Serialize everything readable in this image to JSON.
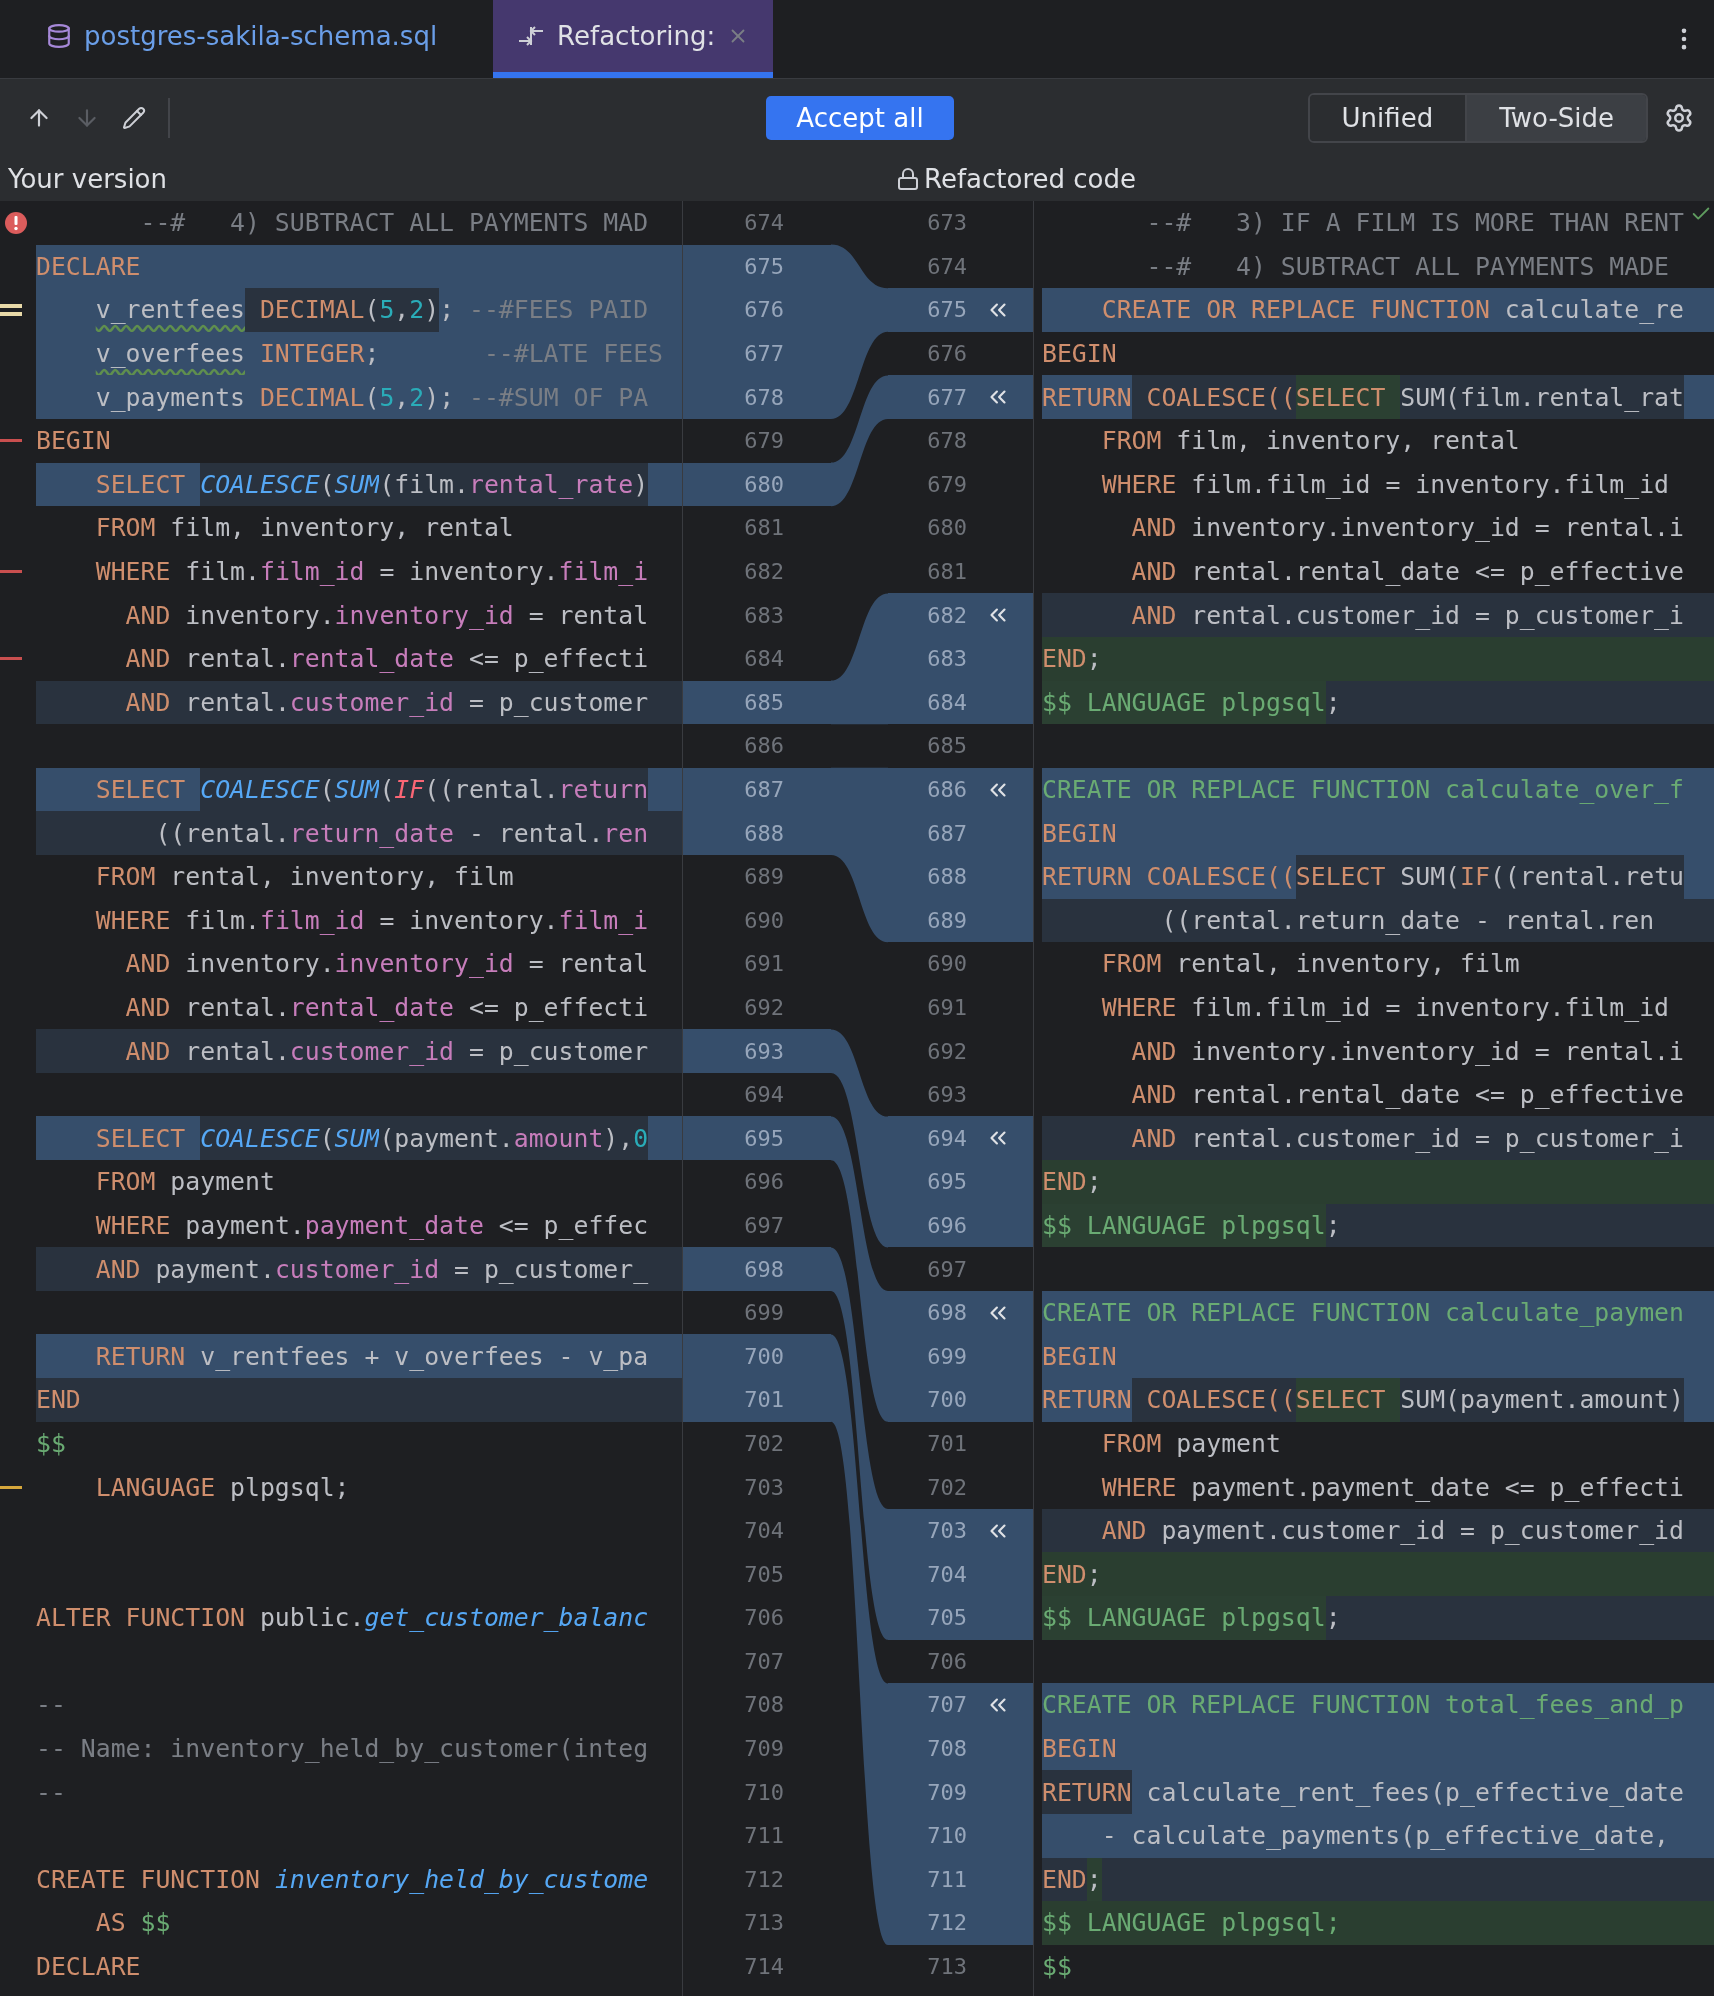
{
  "tabs": [
    {
      "label": "postgres-sakila-schema.sql",
      "kind": "file",
      "selected": false,
      "closable": false
    },
    {
      "label": "Refactoring:",
      "kind": "diff",
      "selected": true,
      "closable": true
    }
  ],
  "toolbar": {
    "nav": [
      {
        "kind": "up",
        "disabled": false
      },
      {
        "kind": "down",
        "disabled": true
      },
      {
        "kind": "edit",
        "disabled": false
      }
    ],
    "accept_button": "Accept all",
    "view_modes": [
      {
        "label": "Unified",
        "selected": false
      },
      {
        "label": "Two-Side",
        "selected": true
      }
    ]
  },
  "panes": {
    "left_title": "Your version",
    "right_title": "Refactored code",
    "right_locked": true
  },
  "rows": [
    {
      "left": {
        "num": "674",
        "kind": "context",
        "marker": {
          "kind": "error"
        },
        "code": [
          {
            "kind": "com",
            "text": "       --#   4) SUBTRACT ALL PAYMENTS MAD"
          }
        ]
      },
      "right": {
        "num": "673",
        "kind": "context",
        "code": [
          {
            "kind": "com",
            "text": "       --#   3) IF A FILM IS MORE THAN RENT"
          }
        ]
      }
    },
    {
      "left": {
        "num": "675",
        "kind": "changed",
        "code": [
          {
            "kind": "kw",
            "text": "DECLARE"
          }
        ]
      },
      "right": {
        "num": "674",
        "kind": "context",
        "code": [
          {
            "kind": "com",
            "text": "       --#   4) SUBTRACT ALL PAYMENTS MADE"
          }
        ]
      }
    },
    {
      "left": {
        "num": "676",
        "kind": "changed",
        "marker": {
          "kind": "warning"
        },
        "code": [
          {
            "kind": "pw",
            "text": "    v_rentfees"
          },
          {
            "kind": "kw",
            "text": " DECIMAL",
            "highlighted": true
          },
          {
            "kind": "p",
            "text": "(",
            "highlighted": true
          },
          {
            "kind": "num",
            "text": "5",
            "highlighted": true
          },
          {
            "kind": "p",
            "text": ",",
            "highlighted": true
          },
          {
            "kind": "num",
            "text": "2",
            "highlighted": true
          },
          {
            "kind": "p",
            "text": ")",
            "highlighted": true
          },
          {
            "kind": "p",
            "text": ";"
          },
          {
            "kind": "com",
            "text": " --#FEES PAID"
          }
        ]
      },
      "right": {
        "num": "675",
        "kind": "changed",
        "code": [
          {
            "kind": "kw",
            "text": "    CREATE OR REPLACE FUNCTION"
          },
          {
            "kind": "p",
            "text": " calculate_re"
          }
        ]
      }
    },
    {
      "left": {
        "num": "677",
        "kind": "changed",
        "code": [
          {
            "kind": "pw",
            "text": "    v_overfees"
          },
          {
            "kind": "kw",
            "text": " INTEGER"
          },
          {
            "kind": "p",
            "text": ";"
          },
          {
            "kind": "com",
            "text": "       --#LATE FEES"
          }
        ]
      },
      "right": {
        "num": "676",
        "kind": "context",
        "code": [
          {
            "kind": "kw",
            "text": "BEGIN"
          }
        ]
      }
    },
    {
      "left": {
        "num": "678",
        "kind": "changed",
        "code": [
          {
            "kind": "p",
            "text": "    v_payments"
          },
          {
            "kind": "kw",
            "text": " DECIMAL"
          },
          {
            "kind": "p",
            "text": "("
          },
          {
            "kind": "num",
            "text": "5"
          },
          {
            "kind": "p",
            "text": ","
          },
          {
            "kind": "num",
            "text": "2"
          },
          {
            "kind": "p",
            "text": ");"
          },
          {
            "kind": "com",
            "text": " --#SUM OF PA"
          }
        ]
      },
      "right": {
        "num": "677",
        "kind": "changed",
        "code": [
          {
            "kind": "kw",
            "text": "RETURN"
          },
          {
            "kind": "kw",
            "text": " COALESCE((",
            "highlighted": true
          },
          {
            "kind": "kw",
            "text": "SELECT ",
            "inserted": true
          },
          {
            "kind": "p",
            "text": "SUM(film.rental_rat",
            "highlighted": true
          }
        ]
      }
    },
    {
      "left": {
        "num": "679",
        "kind": "context",
        "marker": {
          "kind": "error-line"
        },
        "code": [
          {
            "kind": "kw",
            "text": "BEGIN"
          }
        ]
      },
      "right": {
        "num": "678",
        "kind": "context",
        "code": [
          {
            "kind": "kw",
            "text": "    FROM"
          },
          {
            "kind": "p",
            "text": " film, inventory, rental"
          }
        ]
      }
    },
    {
      "left": {
        "num": "680",
        "kind": "changed",
        "code": [
          {
            "kind": "kw",
            "text": "    SELECT "
          },
          {
            "kind": "fn",
            "text": "COALESCE",
            "highlighted": true
          },
          {
            "kind": "p",
            "text": "(",
            "highlighted": true
          },
          {
            "kind": "fn",
            "text": "SUM",
            "highlighted": true
          },
          {
            "kind": "p",
            "text": "(film.",
            "highlighted": true
          },
          {
            "kind": "field",
            "text": "rental_rate",
            "highlighted": true
          },
          {
            "kind": "p",
            "text": ")",
            "highlighted": true
          }
        ]
      },
      "right": {
        "num": "679",
        "kind": "context",
        "code": [
          {
            "kind": "kw",
            "text": "    WHERE"
          },
          {
            "kind": "p",
            "text": " film.film_id = inventory.film_id"
          }
        ]
      }
    },
    {
      "left": {
        "num": "681",
        "kind": "context",
        "code": [
          {
            "kind": "kw",
            "text": "    FROM"
          },
          {
            "kind": "p",
            "text": " film, inventory, rental"
          }
        ]
      },
      "right": {
        "num": "680",
        "kind": "context",
        "code": [
          {
            "kind": "kw",
            "text": "      AND"
          },
          {
            "kind": "p",
            "text": " inventory.inventory_id = rental.i"
          }
        ]
      }
    },
    {
      "left": {
        "num": "682",
        "kind": "context",
        "marker": {
          "kind": "error-line"
        },
        "code": [
          {
            "kind": "kw",
            "text": "    WHERE"
          },
          {
            "kind": "p",
            "text": " film."
          },
          {
            "kind": "field",
            "text": "film_id"
          },
          {
            "kind": "p",
            "text": " = inventory."
          },
          {
            "kind": "field",
            "text": "film_i"
          }
        ]
      },
      "right": {
        "num": "681",
        "kind": "context",
        "code": [
          {
            "kind": "kw",
            "text": "      AND"
          },
          {
            "kind": "p",
            "text": " rental.rental_date <= p_effective"
          }
        ]
      }
    },
    {
      "left": {
        "num": "683",
        "kind": "context",
        "code": [
          {
            "kind": "kw",
            "text": "      AND"
          },
          {
            "kind": "p",
            "text": " inventory."
          },
          {
            "kind": "field",
            "text": "inventory_id"
          },
          {
            "kind": "p",
            "text": " = rental"
          }
        ]
      },
      "right": {
        "num": "682",
        "kind": "modified",
        "code": [
          {
            "kind": "kw",
            "text": "      AND"
          },
          {
            "kind": "p",
            "text": " rental.customer_id = p_customer_i"
          }
        ]
      }
    },
    {
      "left": {
        "num": "684",
        "kind": "context",
        "marker": {
          "kind": "error-line"
        },
        "code": [
          {
            "kind": "kw",
            "text": "      AND"
          },
          {
            "kind": "p",
            "text": " rental."
          },
          {
            "kind": "field",
            "text": "rental_date"
          },
          {
            "kind": "p",
            "text": " <= p_effecti"
          }
        ]
      },
      "right": {
        "num": "683",
        "kind": "inserted",
        "code": [
          {
            "kind": "kw",
            "text": "END"
          },
          {
            "kind": "p",
            "text": ";"
          }
        ]
      }
    },
    {
      "left": {
        "num": "685",
        "kind": "modified",
        "code": [
          {
            "kind": "kw",
            "text": "      AND"
          },
          {
            "kind": "p",
            "text": " rental."
          },
          {
            "kind": "field",
            "text": "customer_id"
          },
          {
            "kind": "p",
            "text": " = p_customer"
          }
        ]
      },
      "right": {
        "num": "684",
        "kind": "modified",
        "code": [
          {
            "kind": "str",
            "text": "$$ LANGUAGE plpgsql",
            "inserted": true
          },
          {
            "kind": "p",
            "text": ";"
          }
        ]
      }
    },
    {
      "left": {
        "num": "686",
        "kind": "context"
      },
      "right": {
        "num": "685",
        "kind": "context"
      }
    },
    {
      "left": {
        "num": "687",
        "kind": "changed",
        "code": [
          {
            "kind": "kw",
            "text": "    SELECT "
          },
          {
            "kind": "fn",
            "text": "COALESCE",
            "highlighted": true
          },
          {
            "kind": "p",
            "text": "(",
            "highlighted": true
          },
          {
            "kind": "fn",
            "text": "SUM",
            "highlighted": true
          },
          {
            "kind": "p",
            "text": "(",
            "highlighted": true
          },
          {
            "kind": "fnred",
            "text": "IF",
            "highlighted": true
          },
          {
            "kind": "p",
            "text": "((rental.",
            "highlighted": true
          },
          {
            "kind": "field",
            "text": "return",
            "highlighted": true
          }
        ]
      },
      "right": {
        "num": "686",
        "kind": "changed",
        "code": [
          {
            "kind": "str",
            "text": "CREATE OR REPLACE FUNCTION calculate_over_f"
          }
        ]
      }
    },
    {
      "left": {
        "num": "688",
        "kind": "modified",
        "code": [
          {
            "kind": "p",
            "text": "        ((rental."
          },
          {
            "kind": "field",
            "text": "return_date"
          },
          {
            "kind": "p",
            "text": " - rental."
          },
          {
            "kind": "field",
            "text": "ren"
          }
        ]
      },
      "right": {
        "num": "687",
        "kind": "changed",
        "code": [
          {
            "kind": "kw",
            "text": "BEGIN"
          }
        ]
      }
    },
    {
      "left": {
        "num": "689",
        "kind": "context",
        "code": [
          {
            "kind": "kw",
            "text": "    FROM"
          },
          {
            "kind": "p",
            "text": " rental, inventory, film"
          }
        ]
      },
      "right": {
        "num": "688",
        "kind": "changed",
        "code": [
          {
            "kind": "kw",
            "text": "RETURN"
          },
          {
            "kind": "kw",
            "text": " COALESCE(("
          },
          {
            "kind": "kw",
            "text": "SELECT",
            "highlighted": true
          },
          {
            "kind": "p",
            "text": " SUM(",
            "highlighted": true
          },
          {
            "kind": "kw",
            "text": "IF",
            "highlighted": true
          },
          {
            "kind": "p",
            "text": "((rental.retu",
            "highlighted": true
          }
        ]
      }
    },
    {
      "left": {
        "num": "690",
        "kind": "context",
        "code": [
          {
            "kind": "kw",
            "text": "    WHERE"
          },
          {
            "kind": "p",
            "text": " film."
          },
          {
            "kind": "field",
            "text": "film_id"
          },
          {
            "kind": "p",
            "text": " = inventory."
          },
          {
            "kind": "field",
            "text": "film_i"
          }
        ]
      },
      "right": {
        "num": "689",
        "kind": "modified",
        "code": [
          {
            "kind": "p",
            "text": "        ((rental.return_date - rental.ren"
          }
        ]
      }
    },
    {
      "left": {
        "num": "691",
        "kind": "context",
        "code": [
          {
            "kind": "kw",
            "text": "      AND"
          },
          {
            "kind": "p",
            "text": " inventory."
          },
          {
            "kind": "field",
            "text": "inventory_id"
          },
          {
            "kind": "p",
            "text": " = rental"
          }
        ]
      },
      "right": {
        "num": "690",
        "kind": "context",
        "code": [
          {
            "kind": "kw",
            "text": "    FROM"
          },
          {
            "kind": "p",
            "text": " rental, inventory, film"
          }
        ]
      }
    },
    {
      "left": {
        "num": "692",
        "kind": "context",
        "code": [
          {
            "kind": "kw",
            "text": "      AND"
          },
          {
            "kind": "p",
            "text": " rental."
          },
          {
            "kind": "field",
            "text": "rental_date"
          },
          {
            "kind": "p",
            "text": " <= p_effecti"
          }
        ]
      },
      "right": {
        "num": "691",
        "kind": "context",
        "code": [
          {
            "kind": "kw",
            "text": "    WHERE"
          },
          {
            "kind": "p",
            "text": " film.film_id = inventory.film_id"
          }
        ]
      }
    },
    {
      "left": {
        "num": "693",
        "kind": "modified",
        "code": [
          {
            "kind": "kw",
            "text": "      AND"
          },
          {
            "kind": "p",
            "text": " rental."
          },
          {
            "kind": "field",
            "text": "customer_id"
          },
          {
            "kind": "p",
            "text": " = p_customer"
          }
        ]
      },
      "right": {
        "num": "692",
        "kind": "context",
        "code": [
          {
            "kind": "kw",
            "text": "      AND"
          },
          {
            "kind": "p",
            "text": " inventory.inventory_id = rental.i"
          }
        ]
      }
    },
    {
      "left": {
        "num": "694",
        "kind": "context"
      },
      "right": {
        "num": "693",
        "kind": "context",
        "code": [
          {
            "kind": "kw",
            "text": "      AND"
          },
          {
            "kind": "p",
            "text": " rental.rental_date <= p_effective"
          }
        ]
      }
    },
    {
      "left": {
        "num": "695",
        "kind": "changed",
        "code": [
          {
            "kind": "kw",
            "text": "    SELECT "
          },
          {
            "kind": "fn",
            "text": "COALESCE",
            "highlighted": true
          },
          {
            "kind": "p",
            "text": "(",
            "highlighted": true
          },
          {
            "kind": "fn",
            "text": "SUM",
            "highlighted": true
          },
          {
            "kind": "p",
            "text": "(payment.",
            "highlighted": true
          },
          {
            "kind": "field",
            "text": "amount",
            "highlighted": true
          },
          {
            "kind": "p",
            "text": ")",
            "highlighted": true
          },
          {
            "kind": "p",
            "text": ",",
            "highlighted": true
          },
          {
            "kind": "num",
            "text": "0",
            "highlighted": true
          }
        ]
      },
      "right": {
        "num": "694",
        "kind": "modified",
        "code": [
          {
            "kind": "kw",
            "text": "      AND"
          },
          {
            "kind": "p",
            "text": " rental.customer_id = p_customer_i"
          }
        ]
      }
    },
    {
      "left": {
        "num": "696",
        "kind": "context",
        "code": [
          {
            "kind": "kw",
            "text": "    FROM"
          },
          {
            "kind": "p",
            "text": " payment"
          }
        ]
      },
      "right": {
        "num": "695",
        "kind": "inserted",
        "code": [
          {
            "kind": "kw",
            "text": "END"
          },
          {
            "kind": "p",
            "text": ";"
          }
        ]
      }
    },
    {
      "left": {
        "num": "697",
        "kind": "context",
        "code": [
          {
            "kind": "kw",
            "text": "    WHERE"
          },
          {
            "kind": "p",
            "text": " payment."
          },
          {
            "kind": "field",
            "text": "payment_date"
          },
          {
            "kind": "p",
            "text": " <= p_effec"
          }
        ]
      },
      "right": {
        "num": "696",
        "kind": "modified",
        "code": [
          {
            "kind": "str",
            "text": "$$ LANGUAGE plpgsql",
            "inserted": true
          },
          {
            "kind": "p",
            "text": ";"
          }
        ]
      }
    },
    {
      "left": {
        "num": "698",
        "kind": "modified",
        "code": [
          {
            "kind": "kw",
            "text": "    AND"
          },
          {
            "kind": "p",
            "text": " payment."
          },
          {
            "kind": "field",
            "text": "customer_id"
          },
          {
            "kind": "p",
            "text": " = p_customer_"
          }
        ]
      },
      "right": {
        "num": "697",
        "kind": "context"
      }
    },
    {
      "left": {
        "num": "699",
        "kind": "context"
      },
      "right": {
        "num": "698",
        "kind": "changed",
        "code": [
          {
            "kind": "str",
            "text": "CREATE OR REPLACE FUNCTION calculate_paymen"
          }
        ]
      }
    },
    {
      "left": {
        "num": "700",
        "kind": "changed",
        "code": [
          {
            "kind": "kw",
            "text": "    RETURN "
          },
          {
            "kind": "p",
            "text": "v_rentfees + v_overfees - v_pa"
          }
        ]
      },
      "right": {
        "num": "699",
        "kind": "changed",
        "code": [
          {
            "kind": "kw",
            "text": "BEGIN"
          }
        ]
      }
    },
    {
      "left": {
        "num": "701",
        "kind": "modified",
        "code": [
          {
            "kind": "kw",
            "text": "END"
          }
        ]
      },
      "right": {
        "num": "700",
        "kind": "changed",
        "code": [
          {
            "kind": "kw",
            "text": "RETURN"
          },
          {
            "kind": "kw",
            "text": " COALESCE((",
            "highlighted": true
          },
          {
            "kind": "kw",
            "text": "SELECT ",
            "inserted": true
          },
          {
            "kind": "p",
            "text": "SUM(payment.amount)",
            "highlighted": true
          }
        ]
      }
    },
    {
      "left": {
        "num": "702",
        "kind": "context",
        "code": [
          {
            "kind": "str",
            "text": "$$"
          }
        ]
      },
      "right": {
        "num": "701",
        "kind": "context",
        "code": [
          {
            "kind": "kw",
            "text": "    FROM"
          },
          {
            "kind": "p",
            "text": " payment"
          }
        ]
      }
    },
    {
      "left": {
        "num": "703",
        "kind": "context",
        "marker": {
          "kind": "warning-line"
        },
        "code": [
          {
            "kind": "kw",
            "text": "    LANGUAGE"
          },
          {
            "kind": "p",
            "text": " plpgsql;"
          }
        ]
      },
      "right": {
        "num": "702",
        "kind": "context",
        "code": [
          {
            "kind": "kw",
            "text": "    WHERE"
          },
          {
            "kind": "p",
            "text": " payment.payment_date <= p_effecti"
          }
        ]
      }
    },
    {
      "left": {
        "num": "704",
        "kind": "context"
      },
      "right": {
        "num": "703",
        "kind": "modified",
        "code": [
          {
            "kind": "kw",
            "text": "    AND"
          },
          {
            "kind": "p",
            "text": " payment.customer_id = p_customer_id"
          }
        ]
      }
    },
    {
      "left": {
        "num": "705",
        "kind": "context"
      },
      "right": {
        "num": "704",
        "kind": "inserted",
        "code": [
          {
            "kind": "kw",
            "text": "END"
          },
          {
            "kind": "p",
            "text": ";"
          }
        ]
      }
    },
    {
      "left": {
        "num": "706",
        "kind": "context",
        "code": [
          {
            "kind": "kw",
            "text": "ALTER FUNCTION"
          },
          {
            "kind": "p",
            "text": " public."
          },
          {
            "kind": "fn",
            "text": "get_customer_balanc"
          }
        ]
      },
      "right": {
        "num": "705",
        "kind": "modified",
        "code": [
          {
            "kind": "str",
            "text": "$$ LANGUAGE plpgsql",
            "inserted": true
          },
          {
            "kind": "p",
            "text": ";"
          }
        ]
      }
    },
    {
      "left": {
        "num": "707",
        "kind": "context"
      },
      "right": {
        "num": "706",
        "kind": "context"
      }
    },
    {
      "left": {
        "num": "708",
        "kind": "context",
        "code": [
          {
            "kind": "com",
            "text": "--"
          }
        ]
      },
      "right": {
        "num": "707",
        "kind": "changed",
        "code": [
          {
            "kind": "str",
            "text": "CREATE OR REPLACE FUNCTION total_fees_and_p"
          }
        ]
      }
    },
    {
      "left": {
        "num": "709",
        "kind": "context",
        "code": [
          {
            "kind": "com",
            "text": "-- Name: inventory_held_by_customer(integ"
          }
        ]
      },
      "right": {
        "num": "708",
        "kind": "changed",
        "code": [
          {
            "kind": "kw",
            "text": "BEGIN"
          }
        ]
      }
    },
    {
      "left": {
        "num": "710",
        "kind": "context",
        "code": [
          {
            "kind": "com",
            "text": "--"
          }
        ]
      },
      "right": {
        "num": "709",
        "kind": "changed",
        "code": [
          {
            "kind": "kw",
            "text": "RETURN",
            "highlighted": true
          },
          {
            "kind": "p",
            "text": " calculate_rent_fees(p_effective_date"
          }
        ]
      }
    },
    {
      "left": {
        "num": "711",
        "kind": "context"
      },
      "right": {
        "num": "710",
        "kind": "changed",
        "code": [
          {
            "kind": "p",
            "text": "    - calculate_payments(p_effective_date,"
          }
        ]
      }
    },
    {
      "left": {
        "num": "712",
        "kind": "context",
        "code": [
          {
            "kind": "kw",
            "text": "CREATE FUNCTION "
          },
          {
            "kind": "fn",
            "text": "inventory_held_by_custome"
          }
        ]
      },
      "right": {
        "num": "711",
        "kind": "modified",
        "code": [
          {
            "kind": "kw",
            "text": "END"
          },
          {
            "kind": "p",
            "text": ";",
            "inserted": true
          }
        ]
      }
    },
    {
      "left": {
        "num": "713",
        "kind": "context",
        "code": [
          {
            "kind": "kw",
            "text": "    AS "
          },
          {
            "kind": "str",
            "text": "$$"
          }
        ]
      },
      "right": {
        "num": "712",
        "kind": "inserted",
        "code": [
          {
            "kind": "str",
            "text": "$$ LANGUAGE plpgsql;"
          }
        ]
      }
    },
    {
      "left": {
        "num": "714",
        "kind": "context",
        "code": [
          {
            "kind": "kw",
            "text": "DECLARE"
          }
        ]
      },
      "right": {
        "num": "713",
        "kind": "context",
        "code": [
          {
            "kind": "str",
            "text": "$$"
          }
        ]
      }
    }
  ]
}
